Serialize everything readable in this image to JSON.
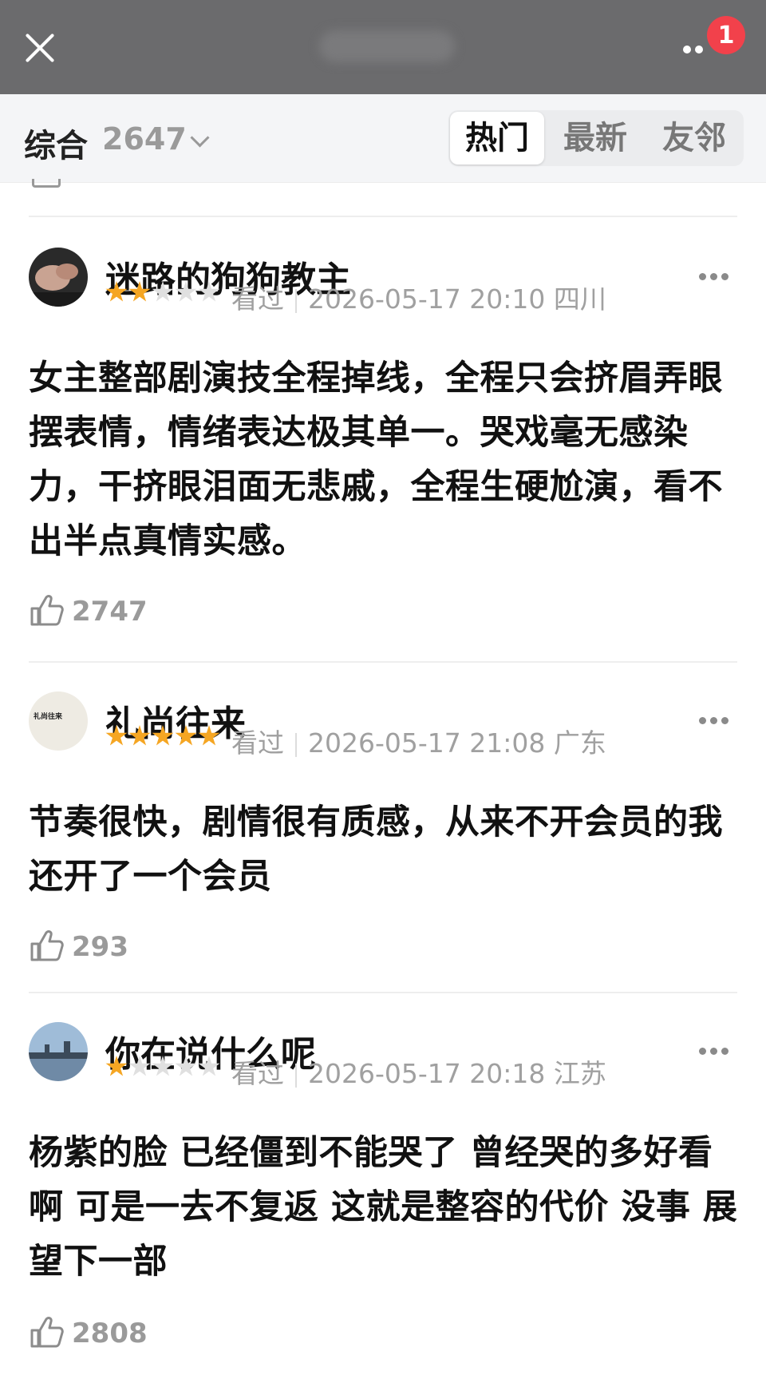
{
  "header": {
    "notification_count": "1"
  },
  "filter": {
    "sort_label": "综合",
    "count": "2647",
    "tabs": [
      "热门",
      "最新",
      "友邻"
    ],
    "active_tab": "热门"
  },
  "reviews": [
    {
      "username": "迷路的狗狗教主",
      "rating": 2,
      "status": "看过",
      "datetime": "2026-05-17 20:10",
      "location": "四川",
      "content": "女主整部剧演技全程掉线，全程只会挤眉弄眼摆表情，情绪表达极其单一。哭戏毫无感染力，干挤眼泪面无悲戚，全程生硬尬演，看不出半点真情实感。",
      "likes": "2747"
    },
    {
      "username": "礼尚往来",
      "avatar_text": "礼尚往来",
      "rating": 5,
      "status": "看过",
      "datetime": "2026-05-17 21:08",
      "location": "广东",
      "content": "节奏很快，剧情很有质感，从来不开会员的我还开了一个会员",
      "likes": "293"
    },
    {
      "username": "你在说什么呢",
      "rating": 1,
      "status": "看过",
      "datetime": "2026-05-17 20:18",
      "location": "江苏",
      "content": "杨紫的脸 已经僵到不能哭了 曾经哭的多好看啊 可是一去不复返 这就是整容的代价 没事 展望下一部",
      "likes": "2808"
    }
  ],
  "colors": {
    "star_on": "#f5a623",
    "star_off": "#e0e0e0",
    "badge": "#f2414b"
  }
}
